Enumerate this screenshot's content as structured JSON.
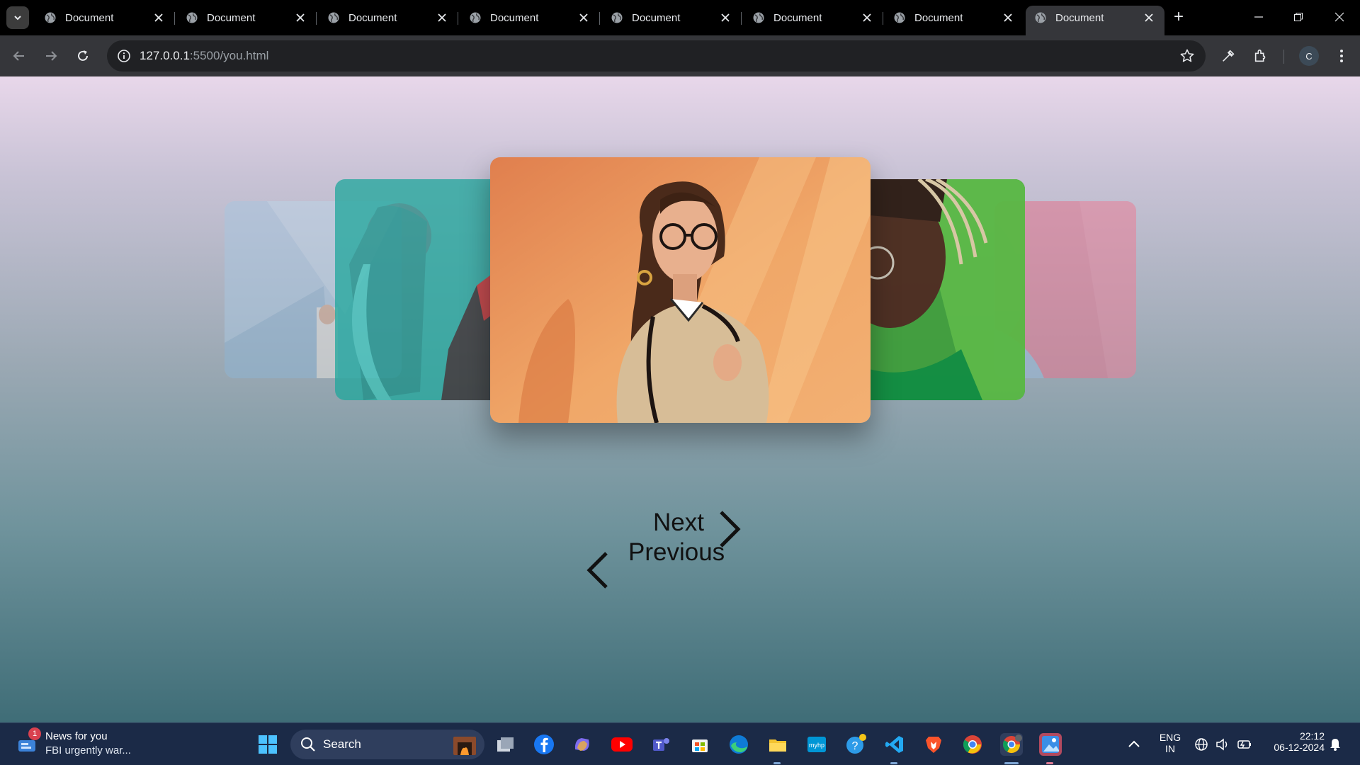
{
  "browser": {
    "tabs": [
      {
        "title": "Document"
      },
      {
        "title": "Document"
      },
      {
        "title": "Document"
      },
      {
        "title": "Document"
      },
      {
        "title": "Document"
      },
      {
        "title": "Document"
      },
      {
        "title": "Document"
      },
      {
        "title": "Document"
      }
    ],
    "active_tab_index": 7,
    "url_host": "127.0.0.1",
    "url_rest": ":5500/you.html",
    "profile_initial": "C"
  },
  "carousel": {
    "next_label": "Next",
    "previous_label": "Previous",
    "colors": {
      "card1": "#a9c6df",
      "card2": "#1fa79c",
      "card3": "#e9945a",
      "card4": "#3e9e3a",
      "card5": "#e07a93"
    }
  },
  "taskbar": {
    "news_title": "News for you",
    "news_subtitle": "FBI urgently war...",
    "news_badge": "1",
    "search_label": "Search",
    "lang_line1": "ENG",
    "lang_line2": "IN",
    "time": "22:12",
    "date": "06-12-2024",
    "icons": [
      "windows-start-icon",
      "task-view-icon",
      "facebook-icon",
      "copilot-icon",
      "youtube-icon",
      "teams-icon",
      "store-icon",
      "edge-icon",
      "file-explorer-icon",
      "myhp-icon",
      "get-help-icon",
      "vscode-icon",
      "brave-icon",
      "chrome-icon",
      "chrome-profile-icon",
      "photos-icon"
    ]
  }
}
